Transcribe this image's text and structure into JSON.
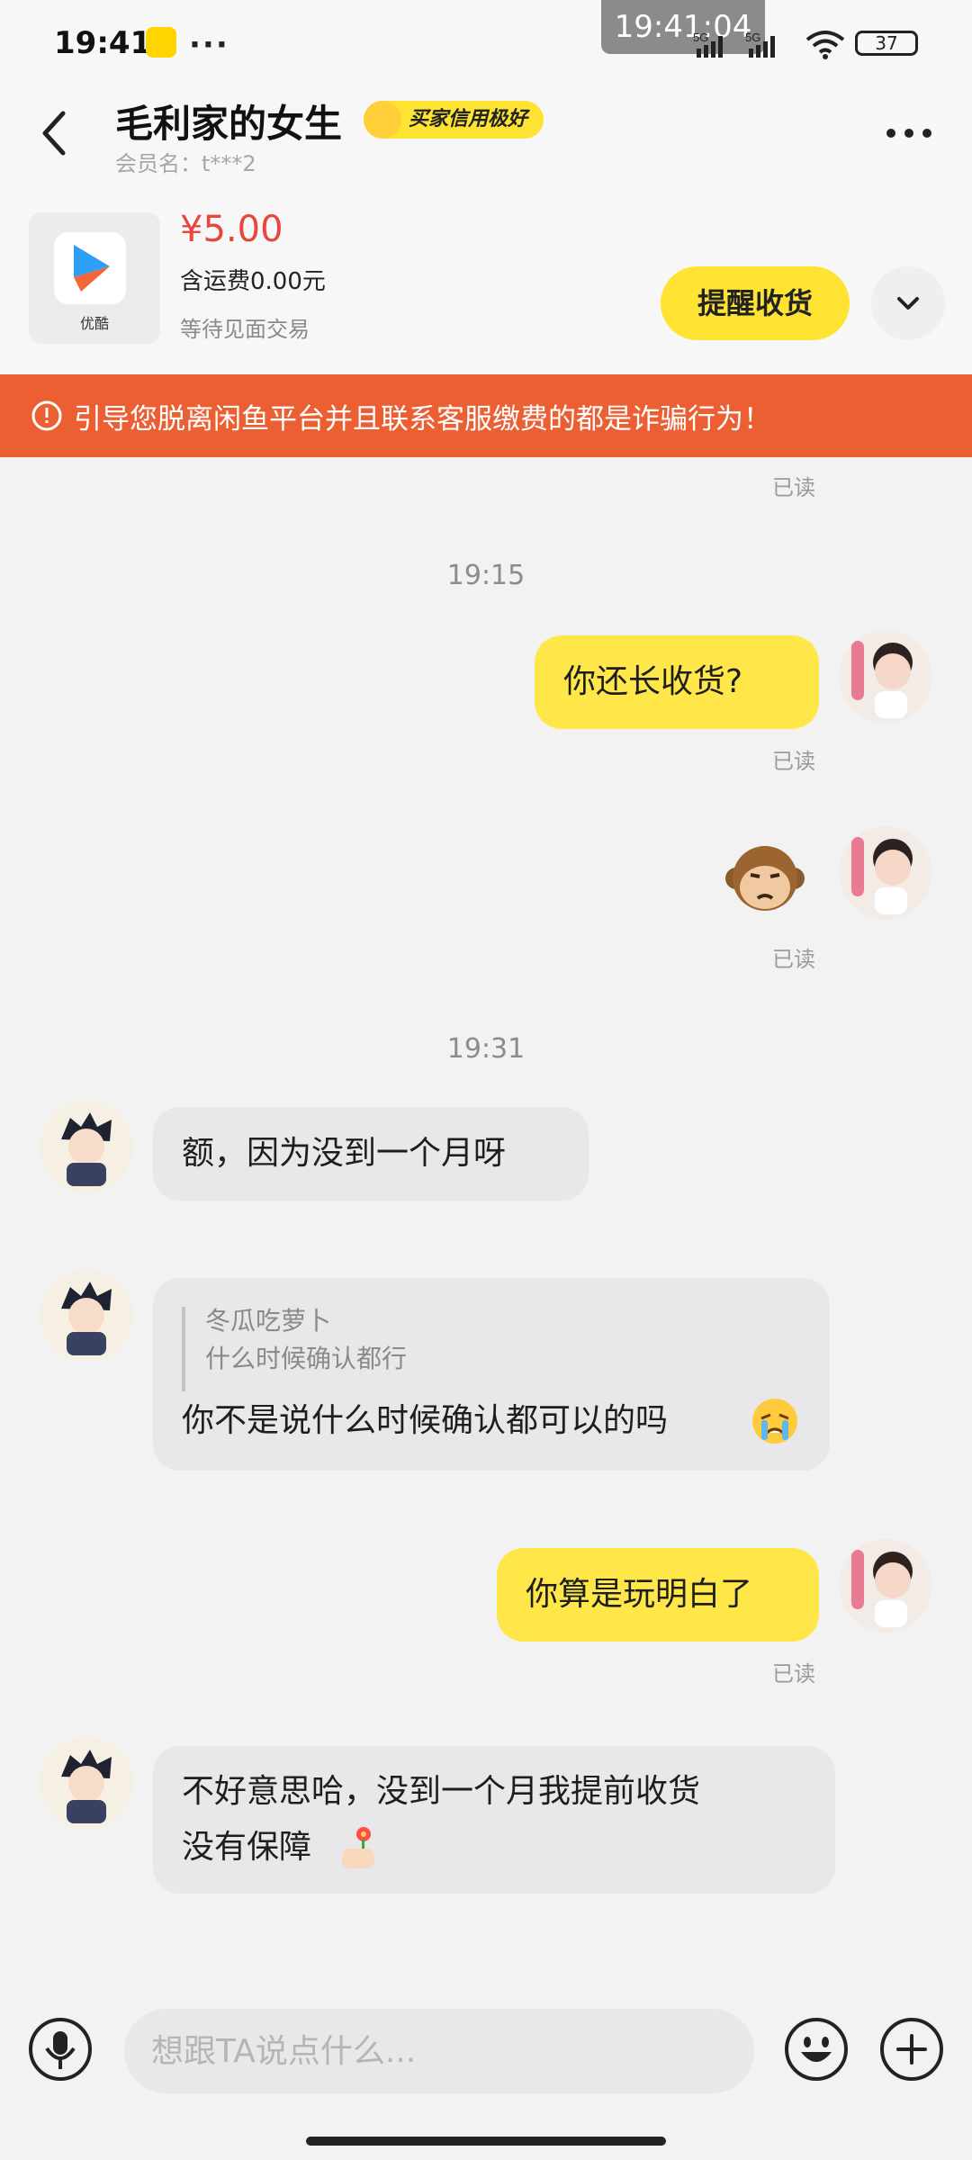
{
  "status_bar": {
    "time": "19:41",
    "overlay_time": "19:41:04",
    "signal_1": "5G",
    "signal_2": "5G",
    "battery": "37"
  },
  "header": {
    "user_name": "毛利家的女生",
    "credit_badge": "买家信用极好",
    "member_name": "会员名：t***2"
  },
  "product": {
    "thumb_label": "优酷",
    "price": "¥5.00",
    "shipping": "含运费0.00元",
    "trade_status": "等待见面交易",
    "remind_button": "提醒收货"
  },
  "warning": {
    "text": "引导您脱离闲鱼平台并且联系客服缴费的都是诈骗行为！"
  },
  "messages": {
    "read_label": "已读",
    "ts_1": "19:15",
    "out_1": "你还长收货?",
    "ts_2": "19:31",
    "in_1": "额，因为没到一个月呀",
    "quote_author": "冬瓜吃萝卜",
    "quote_text": "什么时候确认都行",
    "in_2": "你不是说什么时候确认都可以的吗",
    "out_2": "你算是玩明白了",
    "in_3_line1": "不好意思哈，没到一个月我提前收货",
    "in_3_line2": "没有保障"
  },
  "input": {
    "placeholder": "想跟TA说点什么..."
  },
  "colors": {
    "accent_yellow": "#ffe333",
    "price_red": "#e8453c",
    "warning_orange": "#ec5f33"
  },
  "icons": [
    "back-icon",
    "more-icon",
    "expand-chevron-icon",
    "warning-icon",
    "voice-icon",
    "emoji-icon",
    "plus-icon"
  ]
}
